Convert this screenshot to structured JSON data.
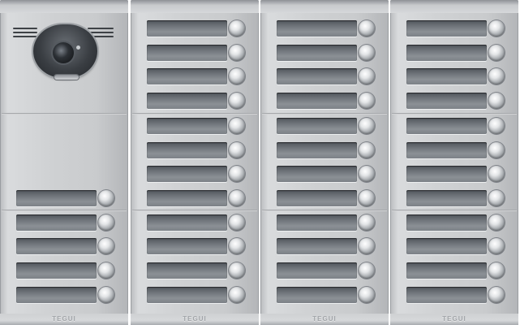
{
  "panel": {
    "brand_label": "TEGUI",
    "columns": [
      {
        "module": "camera-module",
        "call_buttons": 5
      },
      {
        "module": "button-module",
        "call_buttons": 12
      },
      {
        "module": "button-module",
        "call_buttons": 12
      },
      {
        "module": "button-module",
        "call_buttons": 12
      }
    ],
    "colors": {
      "panel_silver": "#cfd1d3",
      "name_tag": "#6f747a",
      "camera_housing": "#3a3e43"
    },
    "icons": [
      "camera-icon",
      "call-button-icon"
    ]
  }
}
